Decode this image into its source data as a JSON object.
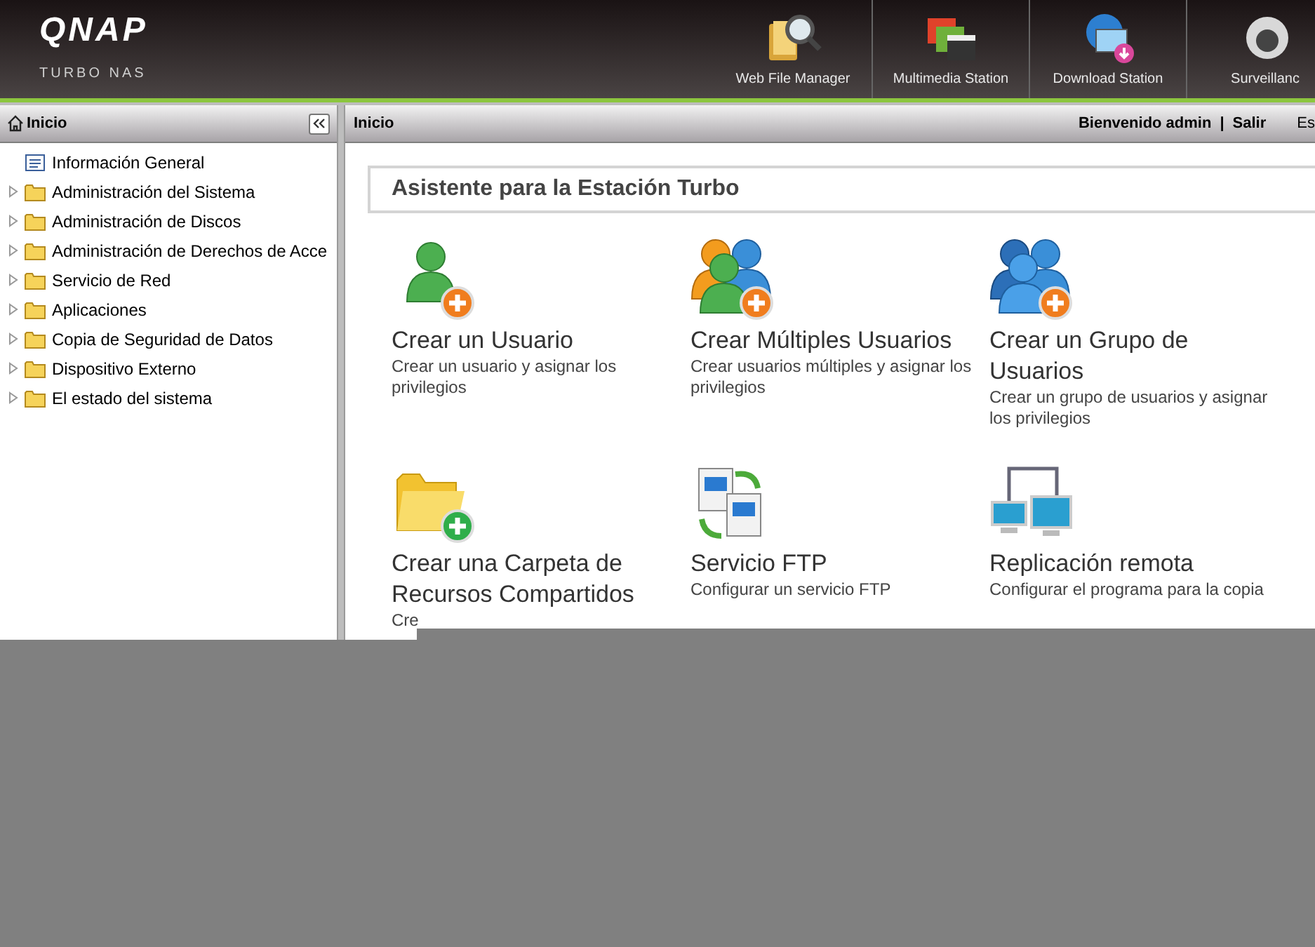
{
  "header": {
    "logo": "QNAP",
    "subtitle": "TURBO NAS",
    "apps": [
      {
        "kind": "file-manager",
        "label": "Web File Manager"
      },
      {
        "kind": "multimedia",
        "label": "Multimedia Station"
      },
      {
        "kind": "download",
        "label": "Download Station"
      },
      {
        "kind": "surveillance",
        "label": "Surveillanc"
      }
    ]
  },
  "sidebar": {
    "title": "Inicio",
    "items": [
      {
        "kind": "page",
        "label": "Información General"
      },
      {
        "kind": "folder",
        "label": "Administración del Sistema",
        "expanded": false
      },
      {
        "kind": "folder",
        "label": "Administración de Discos",
        "expanded": false
      },
      {
        "kind": "folder",
        "label": "Administración de Derechos de Acce",
        "expanded": false
      },
      {
        "kind": "folder",
        "label": "Servicio de Red",
        "expanded": false
      },
      {
        "kind": "folder",
        "label": "Aplicaciones",
        "expanded": false
      },
      {
        "kind": "folder",
        "label": "Copia de Seguridad de Datos",
        "expanded": false
      },
      {
        "kind": "folder",
        "label": "Dispositivo Externo",
        "expanded": false
      },
      {
        "kind": "folder",
        "label": "El estado del sistema",
        "expanded": false
      }
    ]
  },
  "topbar": {
    "breadcrumb": "Inicio",
    "welcome": "Bienvenido admin",
    "separator": "|",
    "logout": "Salir",
    "language": "Es"
  },
  "wizard": {
    "title": "Asistente para la Estación Turbo",
    "items": [
      {
        "kind": "user",
        "title": "Crear un Usuario",
        "description": "Crear un usuario y asignar los privilegios"
      },
      {
        "kind": "users",
        "title": "Crear Múltiples Usuarios",
        "description": "Crear usuarios múltiples y asignar los privilegios"
      },
      {
        "kind": "group",
        "title": "Crear un Grupo de Usuarios",
        "description": "Crear un grupo de usuarios y asignar los privilegios"
      },
      {
        "kind": "share",
        "title": "Crear una Carpeta de Recursos Compartidos",
        "description": "Cre"
      },
      {
        "kind": "ftp",
        "title": "Servicio FTP",
        "description": "Configurar un servicio FTP"
      },
      {
        "kind": "replication",
        "title": "Replicación remota",
        "description": "Configurar el programa para la copia"
      }
    ]
  }
}
